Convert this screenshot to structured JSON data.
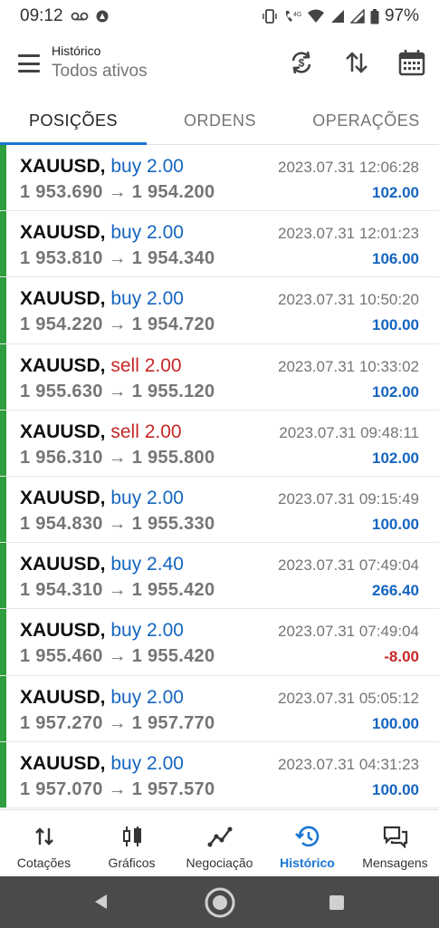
{
  "status_bar": {
    "time": "09:12",
    "battery": "97%",
    "icons": [
      "voicemail-icon",
      "notification-icon",
      "vibrate-icon",
      "volte-icon",
      "wifi-icon",
      "signal-icon",
      "battery-icon"
    ]
  },
  "app_bar": {
    "title": "Histórico",
    "subtitle": "Todos ativos",
    "actions": [
      "sync-currency-icon",
      "sort-icon",
      "calendar-icon"
    ]
  },
  "tabs": [
    {
      "label": "POSIÇÕES",
      "active": true
    },
    {
      "label": "ORDENS",
      "active": false
    },
    {
      "label": "OPERAÇÕES",
      "active": false
    }
  ],
  "positions": [
    {
      "symbol": "XAUUSD,",
      "side": "buy 2.00",
      "type": "buy",
      "open": "1 953.690",
      "arrow": "→",
      "close": "1 954.200",
      "time": "2023.07.31 12:06:28",
      "profit": "102.00"
    },
    {
      "symbol": "XAUUSD,",
      "side": "buy 2.00",
      "type": "buy",
      "open": "1 953.810",
      "arrow": "→",
      "close": "1 954.340",
      "time": "2023.07.31 12:01:23",
      "profit": "106.00"
    },
    {
      "symbol": "XAUUSD,",
      "side": "buy 2.00",
      "type": "buy",
      "open": "1 954.220",
      "arrow": "→",
      "close": "1 954.720",
      "time": "2023.07.31 10:50:20",
      "profit": "100.00"
    },
    {
      "symbol": "XAUUSD,",
      "side": "sell 2.00",
      "type": "sell",
      "open": "1 955.630",
      "arrow": "→",
      "close": "1 955.120",
      "time": "2023.07.31 10:33:02",
      "profit": "102.00"
    },
    {
      "symbol": "XAUUSD,",
      "side": "sell 2.00",
      "type": "sell",
      "open": "1 956.310",
      "arrow": "→",
      "close": "1 955.800",
      "time": "2023.07.31 09:48:11",
      "profit": "102.00"
    },
    {
      "symbol": "XAUUSD,",
      "side": "buy 2.00",
      "type": "buy",
      "open": "1 954.830",
      "arrow": "→",
      "close": "1 955.330",
      "time": "2023.07.31 09:15:49",
      "profit": "100.00"
    },
    {
      "symbol": "XAUUSD,",
      "side": "buy 2.40",
      "type": "buy",
      "open": "1 954.310",
      "arrow": "→",
      "close": "1 955.420",
      "time": "2023.07.31 07:49:04",
      "profit": "266.40"
    },
    {
      "symbol": "XAUUSD,",
      "side": "buy 2.00",
      "type": "buy",
      "open": "1 955.460",
      "arrow": "→",
      "close": "1 955.420",
      "time": "2023.07.31 07:49:04",
      "profit": "-8.00"
    },
    {
      "symbol": "XAUUSD,",
      "side": "buy 2.00",
      "type": "buy",
      "open": "1 957.270",
      "arrow": "→",
      "close": "1 957.770",
      "time": "2023.07.31 05:05:12",
      "profit": "100.00"
    },
    {
      "symbol": "XAUUSD,",
      "side": "buy 2.00",
      "type": "buy",
      "open": "1 957.070",
      "arrow": "→",
      "close": "1 957.570",
      "time": "2023.07.31 04:31:23",
      "profit": "100.00"
    }
  ],
  "bottom_nav": [
    {
      "label": "Cotações",
      "icon": "quotes-icon",
      "active": false
    },
    {
      "label": "Gráficos",
      "icon": "charts-icon",
      "active": false
    },
    {
      "label": "Negociação",
      "icon": "trade-icon",
      "active": false
    },
    {
      "label": "Histórico",
      "icon": "history-icon",
      "active": true
    },
    {
      "label": "Mensagens",
      "icon": "messages-icon",
      "active": false
    }
  ],
  "colors": {
    "accent_blue": "#1976d2",
    "buy_blue": "#1565c0",
    "sell_red": "#c62828",
    "position_bar_green": "#2e9e3e",
    "system_nav_bg": "#4a4a4a"
  }
}
